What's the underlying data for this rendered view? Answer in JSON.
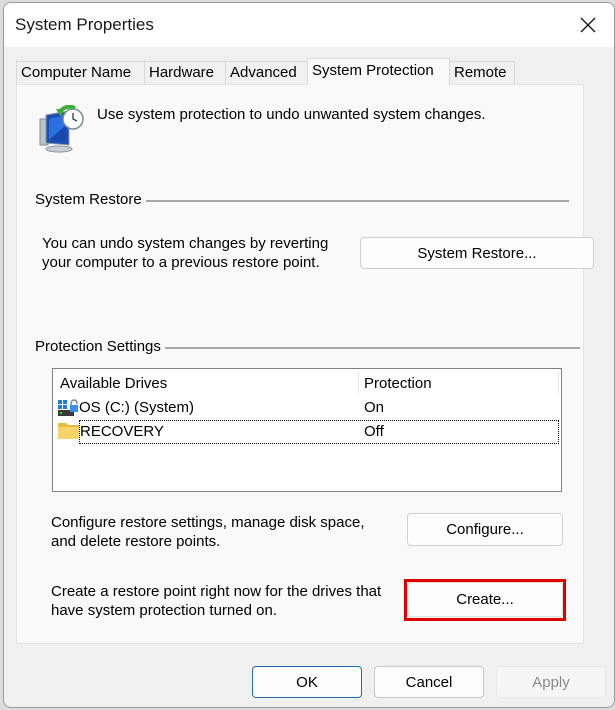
{
  "window": {
    "title": "System Properties",
    "close_icon": "close-icon"
  },
  "tabs": [
    {
      "label": "Computer Name",
      "active": false
    },
    {
      "label": "Hardware",
      "active": false
    },
    {
      "label": "Advanced",
      "active": false
    },
    {
      "label": "System Protection",
      "active": true
    },
    {
      "label": "Remote",
      "active": false
    }
  ],
  "header": {
    "icon": "system-restore-icon",
    "text": "Use system protection to undo unwanted system changes."
  },
  "system_restore": {
    "group_label": "System Restore",
    "description_line1": "You can undo system changes by reverting",
    "description_line2": "your computer to a previous restore point.",
    "button_label": "System Restore..."
  },
  "protection_settings": {
    "group_label": "Protection Settings",
    "columns": [
      "Available Drives",
      "Protection"
    ],
    "drives": [
      {
        "name": "OS (C:) (System)",
        "protection": "On",
        "icon": "system-drive-icon"
      },
      {
        "name": "RECOVERY",
        "protection": "Off",
        "icon": "folder-drive-icon"
      }
    ],
    "configure_text_line1": "Configure restore settings, manage disk space,",
    "configure_text_line2": "and delete restore points.",
    "configure_button": "Configure...",
    "create_text_line1": "Create a restore point right now for the drives that",
    "create_text_line2": "have system protection turned on.",
    "create_button": "Create...",
    "highlight_color": "#e00000"
  },
  "footer": {
    "ok": "OK",
    "cancel": "Cancel",
    "apply": "Apply",
    "apply_enabled": false
  }
}
